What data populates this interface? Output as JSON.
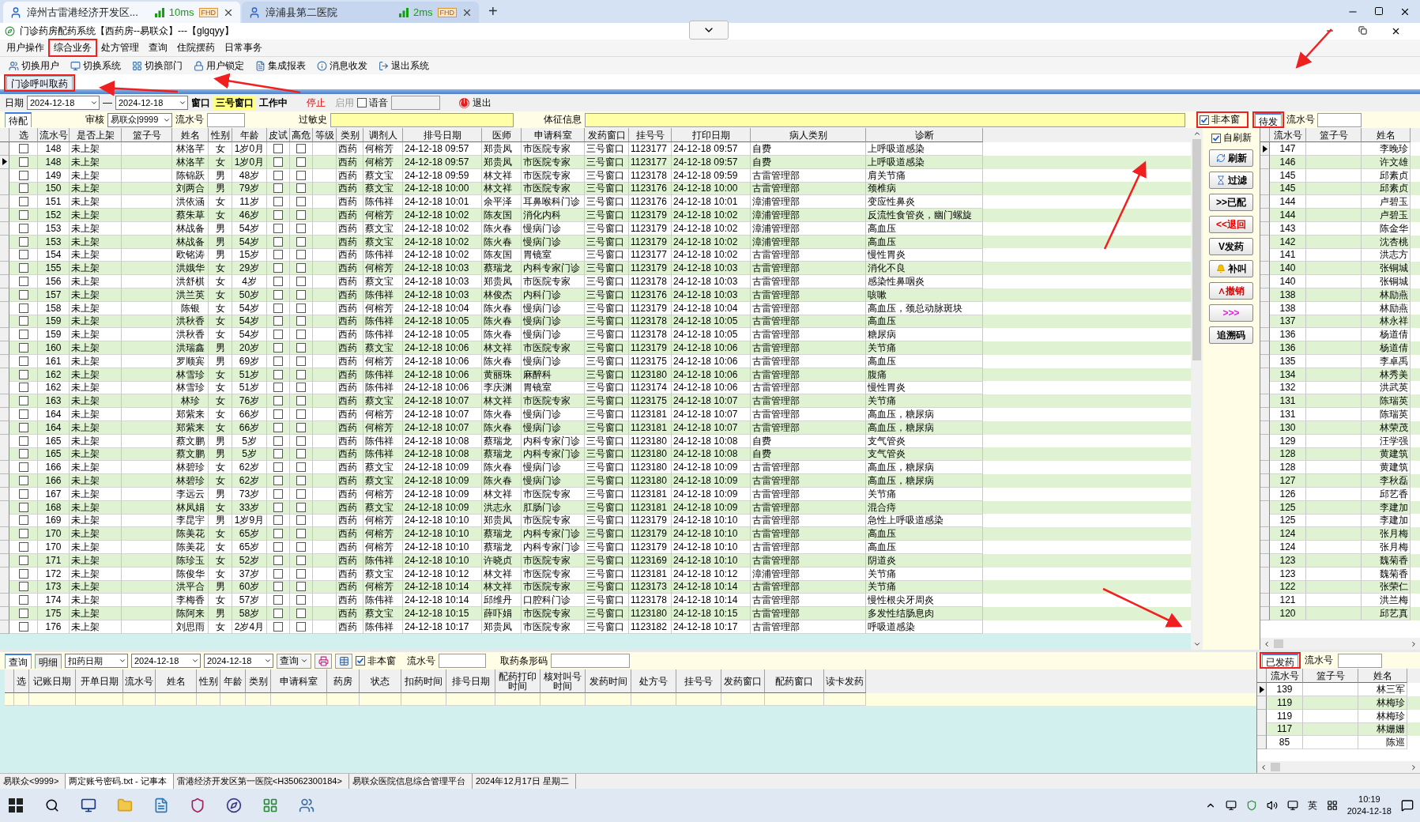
{
  "browser_tabs": [
    {
      "title": "漳州古雷港经济开发区...",
      "latency": "10ms",
      "badge": "FHD",
      "selected": true
    },
    {
      "title": "漳浦县第二医院",
      "latency": "2ms",
      "badge": "FHD",
      "selected": false
    }
  ],
  "new_tab": "+",
  "window": {
    "title": "门诊药房配药系统【西药房--易联众】---【glgqyy】"
  },
  "menu": [
    "用户操作",
    "综合业务",
    "处方管理",
    "查询",
    "住院摆药",
    "日常事务"
  ],
  "toolbar": [
    {
      "label": "切换用户",
      "kind": "users"
    },
    {
      "label": "切换系统",
      "kind": "system"
    },
    {
      "label": "切换部门",
      "kind": "dept"
    },
    {
      "label": "用户锁定",
      "kind": "lock"
    },
    {
      "label": "集成报表",
      "kind": "report"
    },
    {
      "label": "消息收发",
      "kind": "info"
    },
    {
      "label": "退出系统",
      "kind": "exit"
    }
  ],
  "page_tabs": [
    {
      "label": "门诊呼叫取药",
      "selected": true
    }
  ],
  "filter": {
    "date_label": "日期",
    "date_from": "2024-12-18",
    "date_sep": "—",
    "date_to": "2024-12-18",
    "window_label": "窗口",
    "window_value": "三号窗口",
    "status": "工作中",
    "stop": "停止",
    "enable": "启用",
    "voice": {
      "label": "语音",
      "checked": false
    },
    "exit": "退出"
  },
  "filter2": {
    "tab": "待配",
    "audit_label": "审核",
    "audit_value": "易联众|9999",
    "serial_label": "流水号",
    "allergy_label": "过敏史",
    "vitals_label": "体征信息"
  },
  "options": [
    {
      "label": "非本窗",
      "checked": true
    },
    {
      "label": "自刷新",
      "checked": true
    }
  ],
  "main_table": {
    "columns": [
      "选",
      "流水号",
      "是否上架",
      "篮子号",
      "姓名",
      "性别",
      "年龄",
      "皮试",
      "高危",
      "等级",
      "类别",
      "调剂人",
      "排号日期",
      "医师",
      "申请科室",
      "发药窗口",
      "挂号号",
      "打印日期",
      "病人类别",
      "诊断"
    ],
    "rows": [
      {
        "selected": false,
        "cells": [
          false,
          "148",
          "未上架",
          "",
          "林洛芊",
          "女",
          "1岁0月",
          false,
          false,
          "",
          "西药",
          "何榕芳",
          "24-12-18 09:57",
          "郑贵凤",
          "市医院专家",
          "三号窗口",
          "1123177",
          "24-12-18 09:57",
          "自费",
          "上呼吸道感染"
        ]
      },
      {
        "selected": true,
        "cells": [
          false,
          "148",
          "未上架",
          "",
          "林洛芊",
          "女",
          "1岁0月",
          false,
          false,
          "",
          "西药",
          "何榕芳",
          "24-12-18 09:57",
          "郑贵凤",
          "市医院专家",
          "三号窗口",
          "1123177",
          "24-12-18 09:57",
          "自费",
          "上呼吸道感染"
        ]
      },
      {
        "selected": false,
        "cells": [
          false,
          "149",
          "未上架",
          "",
          "陈锦跃",
          "男",
          "48岁",
          false,
          false,
          "",
          "西药",
          "蔡文宝",
          "24-12-18 09:59",
          "林文祥",
          "市医院专家",
          "三号窗口",
          "1123178",
          "24-12-18 09:59",
          "古雷管理部",
          "肩关节痛"
        ]
      },
      {
        "selected": false,
        "cells": [
          false,
          "150",
          "未上架",
          "",
          "刘两合",
          "男",
          "79岁",
          false,
          false,
          "",
          "西药",
          "蔡文宝",
          "24-12-18 10:00",
          "林文祥",
          "市医院专家",
          "三号窗口",
          "1123176",
          "24-12-18 10:00",
          "古雷管理部",
          "颈椎病"
        ]
      },
      {
        "selected": false,
        "cells": [
          false,
          "151",
          "未上架",
          "",
          "洪依涵",
          "女",
          "11岁",
          false,
          false,
          "",
          "西药",
          "陈伟祥",
          "24-12-18 10:01",
          "余平泽",
          "耳鼻喉科门诊",
          "三号窗口",
          "1123176",
          "24-12-18 10:01",
          "漳浦管理部",
          "变应性鼻炎"
        ]
      },
      {
        "selected": false,
        "cells": [
          false,
          "152",
          "未上架",
          "",
          "蔡朱草",
          "女",
          "46岁",
          false,
          false,
          "",
          "西药",
          "何榕芳",
          "24-12-18 10:02",
          "陈友国",
          "消化内科",
          "三号窗口",
          "1123179",
          "24-12-18 10:02",
          "漳浦管理部",
          "反流性食管炎，幽门螺旋"
        ]
      },
      {
        "selected": false,
        "cells": [
          false,
          "153",
          "未上架",
          "",
          "林战备",
          "男",
          "54岁",
          false,
          false,
          "",
          "西药",
          "蔡文宝",
          "24-12-18 10:02",
          "陈火春",
          "慢病门诊",
          "三号窗口",
          "1123179",
          "24-12-18 10:02",
          "漳浦管理部",
          "高血压"
        ]
      },
      {
        "selected": false,
        "cells": [
          false,
          "153",
          "未上架",
          "",
          "林战备",
          "男",
          "54岁",
          false,
          false,
          "",
          "西药",
          "蔡文宝",
          "24-12-18 10:02",
          "陈火春",
          "慢病门诊",
          "三号窗口",
          "1123179",
          "24-12-18 10:02",
          "漳浦管理部",
          "高血压"
        ]
      },
      {
        "selected": false,
        "cells": [
          false,
          "154",
          "未上架",
          "",
          "欧铭涛",
          "男",
          "15岁",
          false,
          false,
          "",
          "西药",
          "陈伟祥",
          "24-12-18 10:02",
          "陈友国",
          "胃镜室",
          "三号窗口",
          "1123177",
          "24-12-18 10:02",
          "古雷管理部",
          "慢性胃炎"
        ]
      },
      {
        "selected": false,
        "cells": [
          false,
          "155",
          "未上架",
          "",
          "洪娥华",
          "女",
          "29岁",
          false,
          false,
          "",
          "西药",
          "何榕芳",
          "24-12-18 10:03",
          "蔡瑞龙",
          "内科专家门诊",
          "三号窗口",
          "1123179",
          "24-12-18 10:03",
          "古雷管理部",
          "消化不良"
        ]
      },
      {
        "selected": false,
        "cells": [
          false,
          "156",
          "未上架",
          "",
          "洪舒棋",
          "女",
          "4岁",
          false,
          false,
          "",
          "西药",
          "蔡文宝",
          "24-12-18 10:03",
          "郑贵凤",
          "市医院专家",
          "三号窗口",
          "1123178",
          "24-12-18 10:03",
          "古雷管理部",
          "感染性鼻咽炎"
        ]
      },
      {
        "selected": false,
        "cells": [
          false,
          "157",
          "未上架",
          "",
          "洪兰英",
          "女",
          "50岁",
          false,
          false,
          "",
          "西药",
          "陈伟祥",
          "24-12-18 10:03",
          "林俊杰",
          "内科门诊",
          "三号窗口",
          "1123176",
          "24-12-18 10:03",
          "古雷管理部",
          "咳嗽"
        ]
      },
      {
        "selected": false,
        "cells": [
          false,
          "158",
          "未上架",
          "",
          "陈银",
          "女",
          "54岁",
          false,
          false,
          "",
          "西药",
          "何榕芳",
          "24-12-18 10:04",
          "陈火春",
          "慢病门诊",
          "三号窗口",
          "1123179",
          "24-12-18 10:04",
          "古雷管理部",
          "高血压，颈总动脉斑块"
        ]
      },
      {
        "selected": false,
        "cells": [
          false,
          "159",
          "未上架",
          "",
          "洪秋香",
          "女",
          "54岁",
          false,
          false,
          "",
          "西药",
          "陈伟祥",
          "24-12-18 10:05",
          "陈火春",
          "慢病门诊",
          "三号窗口",
          "1123178",
          "24-12-18 10:05",
          "古雷管理部",
          "高血压"
        ]
      },
      {
        "selected": false,
        "cells": [
          false,
          "159",
          "未上架",
          "",
          "洪秋香",
          "女",
          "54岁",
          false,
          false,
          "",
          "西药",
          "陈伟祥",
          "24-12-18 10:05",
          "陈火春",
          "慢病门诊",
          "三号窗口",
          "1123178",
          "24-12-18 10:05",
          "古雷管理部",
          "糖尿病"
        ]
      },
      {
        "selected": false,
        "cells": [
          false,
          "160",
          "未上架",
          "",
          "洪瑞鑫",
          "男",
          "20岁",
          false,
          false,
          "",
          "西药",
          "蔡文宝",
          "24-12-18 10:06",
          "林文祥",
          "市医院专家",
          "三号窗口",
          "1123179",
          "24-12-18 10:06",
          "古雷管理部",
          "关节痛"
        ]
      },
      {
        "selected": false,
        "cells": [
          false,
          "161",
          "未上架",
          "",
          "罗顺宾",
          "男",
          "69岁",
          false,
          false,
          "",
          "西药",
          "何榕芳",
          "24-12-18 10:06",
          "陈火春",
          "慢病门诊",
          "三号窗口",
          "1123175",
          "24-12-18 10:06",
          "古雷管理部",
          "高血压"
        ]
      },
      {
        "selected": false,
        "cells": [
          false,
          "162",
          "未上架",
          "",
          "林雪珍",
          "女",
          "51岁",
          false,
          false,
          "",
          "西药",
          "陈伟祥",
          "24-12-18 10:06",
          "黄丽珠",
          "麻醉科",
          "三号窗口",
          "1123180",
          "24-12-18 10:06",
          "古雷管理部",
          "腹痛"
        ]
      },
      {
        "selected": false,
        "cells": [
          false,
          "162",
          "未上架",
          "",
          "林雪珍",
          "女",
          "51岁",
          false,
          false,
          "",
          "西药",
          "陈伟祥",
          "24-12-18 10:06",
          "李庆渊",
          "胃镜室",
          "三号窗口",
          "1123174",
          "24-12-18 10:06",
          "古雷管理部",
          "慢性胃炎"
        ]
      },
      {
        "selected": false,
        "cells": [
          false,
          "163",
          "未上架",
          "",
          "林珍",
          "女",
          "76岁",
          false,
          false,
          "",
          "西药",
          "蔡文宝",
          "24-12-18 10:07",
          "林文祥",
          "市医院专家",
          "三号窗口",
          "1123175",
          "24-12-18 10:07",
          "古雷管理部",
          "关节痛"
        ]
      },
      {
        "selected": false,
        "cells": [
          false,
          "164",
          "未上架",
          "",
          "郑紫来",
          "女",
          "66岁",
          false,
          false,
          "",
          "西药",
          "何榕芳",
          "24-12-18 10:07",
          "陈火春",
          "慢病门诊",
          "三号窗口",
          "1123181",
          "24-12-18 10:07",
          "古雷管理部",
          "高血压，糖尿病"
        ]
      },
      {
        "selected": false,
        "cells": [
          false,
          "164",
          "未上架",
          "",
          "郑紫来",
          "女",
          "66岁",
          false,
          false,
          "",
          "西药",
          "何榕芳",
          "24-12-18 10:07",
          "陈火春",
          "慢病门诊",
          "三号窗口",
          "1123181",
          "24-12-18 10:07",
          "古雷管理部",
          "高血压，糖尿病"
        ]
      },
      {
        "selected": false,
        "cells": [
          false,
          "165",
          "未上架",
          "",
          "蔡文鹏",
          "男",
          "5岁",
          false,
          false,
          "",
          "西药",
          "陈伟祥",
          "24-12-18 10:08",
          "蔡瑞龙",
          "内科专家门诊",
          "三号窗口",
          "1123180",
          "24-12-18 10:08",
          "自费",
          "支气管炎"
        ]
      },
      {
        "selected": false,
        "cells": [
          false,
          "165",
          "未上架",
          "",
          "蔡文鹏",
          "男",
          "5岁",
          false,
          false,
          "",
          "西药",
          "陈伟祥",
          "24-12-18 10:08",
          "蔡瑞龙",
          "内科专家门诊",
          "三号窗口",
          "1123180",
          "24-12-18 10:08",
          "自费",
          "支气管炎"
        ]
      },
      {
        "selected": false,
        "cells": [
          false,
          "166",
          "未上架",
          "",
          "林碧珍",
          "女",
          "62岁",
          false,
          false,
          "",
          "西药",
          "蔡文宝",
          "24-12-18 10:09",
          "陈火春",
          "慢病门诊",
          "三号窗口",
          "1123180",
          "24-12-18 10:09",
          "古雷管理部",
          "高血压，糖尿病"
        ]
      },
      {
        "selected": false,
        "cells": [
          false,
          "166",
          "未上架",
          "",
          "林碧珍",
          "女",
          "62岁",
          false,
          false,
          "",
          "西药",
          "蔡文宝",
          "24-12-18 10:09",
          "陈火春",
          "慢病门诊",
          "三号窗口",
          "1123180",
          "24-12-18 10:09",
          "古雷管理部",
          "高血压，糖尿病"
        ]
      },
      {
        "selected": false,
        "cells": [
          false,
          "167",
          "未上架",
          "",
          "李远云",
          "男",
          "73岁",
          false,
          false,
          "",
          "西药",
          "何榕芳",
          "24-12-18 10:09",
          "林文祥",
          "市医院专家",
          "三号窗口",
          "1123181",
          "24-12-18 10:09",
          "古雷管理部",
          "关节痛"
        ]
      },
      {
        "selected": false,
        "cells": [
          false,
          "168",
          "未上架",
          "",
          "林凤娟",
          "女",
          "33岁",
          false,
          false,
          "",
          "西药",
          "蔡文宝",
          "24-12-18 10:09",
          "洪志永",
          "肛肠门诊",
          "三号窗口",
          "1123181",
          "24-12-18 10:09",
          "古雷管理部",
          "混合痔"
        ]
      },
      {
        "selected": false,
        "cells": [
          false,
          "169",
          "未上架",
          "",
          "李昆宇",
          "男",
          "1岁9月",
          false,
          false,
          "",
          "西药",
          "何榕芳",
          "24-12-18 10:10",
          "郑贵凤",
          "市医院专家",
          "三号窗口",
          "1123179",
          "24-12-18 10:10",
          "古雷管理部",
          "急性上呼吸道感染"
        ]
      },
      {
        "selected": false,
        "cells": [
          false,
          "170",
          "未上架",
          "",
          "陈美花",
          "女",
          "65岁",
          false,
          false,
          "",
          "西药",
          "何榕芳",
          "24-12-18 10:10",
          "蔡瑞龙",
          "内科专家门诊",
          "三号窗口",
          "1123179",
          "24-12-18 10:10",
          "古雷管理部",
          "高血压"
        ]
      },
      {
        "selected": false,
        "cells": [
          false,
          "170",
          "未上架",
          "",
          "陈美花",
          "女",
          "65岁",
          false,
          false,
          "",
          "西药",
          "何榕芳",
          "24-12-18 10:10",
          "蔡瑞龙",
          "内科专家门诊",
          "三号窗口",
          "1123179",
          "24-12-18 10:10",
          "古雷管理部",
          "高血压"
        ]
      },
      {
        "selected": false,
        "cells": [
          false,
          "171",
          "未上架",
          "",
          "陈珍玉",
          "女",
          "52岁",
          false,
          false,
          "",
          "西药",
          "陈伟祥",
          "24-12-18 10:10",
          "许晓贞",
          "市医院专家",
          "三号窗口",
          "1123169",
          "24-12-18 10:10",
          "古雷管理部",
          "阴道炎"
        ]
      },
      {
        "selected": false,
        "cells": [
          false,
          "172",
          "未上架",
          "",
          "陈俊华",
          "女",
          "37岁",
          false,
          false,
          "",
          "西药",
          "蔡文宝",
          "24-12-18 10:12",
          "林文祥",
          "市医院专家",
          "三号窗口",
          "1123181",
          "24-12-18 10:12",
          "漳浦管理部",
          "关节痛"
        ]
      },
      {
        "selected": false,
        "cells": [
          false,
          "173",
          "未上架",
          "",
          "洪平合",
          "男",
          "60岁",
          false,
          false,
          "",
          "西药",
          "何榕芳",
          "24-12-18 10:14",
          "林文祥",
          "市医院专家",
          "三号窗口",
          "1123173",
          "24-12-18 10:14",
          "古雷管理部",
          "关节痛"
        ]
      },
      {
        "selected": false,
        "cells": [
          false,
          "174",
          "未上架",
          "",
          "李梅香",
          "女",
          "57岁",
          false,
          false,
          "",
          "西药",
          "陈伟祥",
          "24-12-18 10:14",
          "邱维丹",
          "口腔科门诊",
          "三号窗口",
          "1123178",
          "24-12-18 10:14",
          "古雷管理部",
          "慢性根尖牙周炎"
        ]
      },
      {
        "selected": false,
        "cells": [
          false,
          "175",
          "未上架",
          "",
          "陈阿来",
          "男",
          "58岁",
          false,
          false,
          "",
          "西药",
          "蔡文宝",
          "24-12-18 10:15",
          "薛吓娟",
          "市医院专家",
          "三号窗口",
          "1123180",
          "24-12-18 10:15",
          "古雷管理部",
          "多发性结肠息肉"
        ]
      },
      {
        "selected": false,
        "cells": [
          false,
          "176",
          "未上架",
          "",
          "刘思雨",
          "女",
          "2岁4月",
          false,
          false,
          "",
          "西药",
          "陈伟祥",
          "24-12-18 10:17",
          "郑贵凤",
          "市医院专家",
          "三号窗口",
          "1123182",
          "24-12-18 10:17",
          "古雷管理部",
          "呼吸道感染"
        ]
      }
    ]
  },
  "actions": [
    {
      "label": "刷新",
      "kind": "refresh"
    },
    {
      "label": "过滤",
      "kind": "filter"
    },
    {
      "label": ">>已配",
      "kind": "text"
    },
    {
      "label": "<<退回",
      "kind": "alert"
    },
    {
      "label": "V发药",
      "kind": "text"
    },
    {
      "label": "补叫",
      "kind": "bell"
    },
    {
      "label": "∧撤销",
      "kind": "alert"
    },
    {
      "label": ">>>",
      "kind": "more"
    },
    {
      "label": "追溯码",
      "kind": "text"
    }
  ],
  "pending": {
    "tab": "待发",
    "serial_label": "流水号",
    "columns": [
      "流水号",
      "篮子号",
      "姓名"
    ],
    "rows": [
      {
        "selected": true,
        "seq": "147",
        "name": "李晚珍"
      },
      {
        "selected": false,
        "seq": "146",
        "name": "许文雄"
      },
      {
        "selected": false,
        "seq": "145",
        "name": "邱素贞"
      },
      {
        "selected": false,
        "seq": "145",
        "name": "邱素贞"
      },
      {
        "selected": false,
        "seq": "144",
        "name": "卢碧玉"
      },
      {
        "selected": false,
        "seq": "144",
        "name": "卢碧玉"
      },
      {
        "selected": false,
        "seq": "143",
        "name": "陈金华"
      },
      {
        "selected": false,
        "seq": "142",
        "name": "沈杏桃"
      },
      {
        "selected": false,
        "seq": "141",
        "name": "洪志方"
      },
      {
        "selected": false,
        "seq": "140",
        "name": "张铜城"
      },
      {
        "selected": false,
        "seq": "140",
        "name": "张铜城"
      },
      {
        "selected": false,
        "seq": "138",
        "name": "林励燕"
      },
      {
        "selected": false,
        "seq": "138",
        "name": "林励燕"
      },
      {
        "selected": false,
        "seq": "137",
        "name": "林永祥"
      },
      {
        "selected": false,
        "seq": "136",
        "name": "杨道倩"
      },
      {
        "selected": false,
        "seq": "136",
        "name": "杨道倩"
      },
      {
        "selected": false,
        "seq": "135",
        "name": "李卓禹"
      },
      {
        "selected": false,
        "seq": "134",
        "name": "林秀美"
      },
      {
        "selected": false,
        "seq": "132",
        "name": "洪武英"
      },
      {
        "selected": false,
        "seq": "131",
        "name": "陈瑞英"
      },
      {
        "selected": false,
        "seq": "131",
        "name": "陈瑞英"
      },
      {
        "selected": false,
        "seq": "130",
        "name": "林荣茂"
      },
      {
        "selected": false,
        "seq": "129",
        "name": "汪学强"
      },
      {
        "selected": false,
        "seq": "128",
        "name": "黄建筑"
      },
      {
        "selected": false,
        "seq": "128",
        "name": "黄建筑"
      },
      {
        "selected": false,
        "seq": "127",
        "name": "李秋磊"
      },
      {
        "selected": false,
        "seq": "126",
        "name": "邱艺香"
      },
      {
        "selected": false,
        "seq": "125",
        "name": "李建加"
      },
      {
        "selected": false,
        "seq": "125",
        "name": "李建加"
      },
      {
        "selected": false,
        "seq": "124",
        "name": "张月梅"
      },
      {
        "selected": false,
        "seq": "124",
        "name": "张月梅"
      },
      {
        "selected": false,
        "seq": "123",
        "name": "魏菊香"
      },
      {
        "selected": false,
        "seq": "123",
        "name": "魏菊香"
      },
      {
        "selected": false,
        "seq": "122",
        "name": "张荣仁"
      },
      {
        "selected": false,
        "seq": "121",
        "name": "洪兰梅"
      },
      {
        "selected": false,
        "seq": "120",
        "name": "邱艺真"
      }
    ]
  },
  "bottom": {
    "tabs": [
      {
        "label": "查询",
        "selected": true
      },
      {
        "label": "明细",
        "selected": false
      }
    ],
    "date_type": "扣药日期",
    "date_from": "2024-12-18",
    "date_to": "2024-12-18",
    "query": "查询",
    "not_this_window": {
      "label": "非本窗",
      "checked": true
    },
    "serial_label": "流水号",
    "barcode_label": "取药条形码",
    "columns": [
      "选",
      "记账日期",
      "开单日期",
      "流水号",
      "姓名",
      "性别",
      "年龄",
      "类别",
      "申请科室",
      "药房",
      "状态",
      "扣药时间",
      "排号日期",
      "配药打印时间",
      "核对叫号时间",
      "发药时间",
      "处方号",
      "挂号号",
      "发药窗口",
      "配药窗口",
      "读卡发药"
    ]
  },
  "dispensed": {
    "tab": "已发药",
    "serial_label": "流水号",
    "columns": [
      "流水号",
      "篮子号",
      "姓名"
    ],
    "rows": [
      {
        "selected": true,
        "seq": "139",
        "name": "林三军"
      },
      {
        "selected": false,
        "seq": "119",
        "name": "林梅珍"
      },
      {
        "selected": false,
        "seq": "119",
        "name": "林梅珍"
      },
      {
        "selected": false,
        "seq": "117",
        "name": "林姗姗"
      },
      {
        "selected": false,
        "seq": "85",
        "name": "陈巡"
      }
    ]
  },
  "status_bar": [
    "易联众<9999>",
    "两定账号密码.txt - 记事本",
    "雷港经济开发区第一医院<H35062300184>",
    "易联众医院信息综合管理平台",
    "2024年12月17日 星期二"
  ],
  "taskbar": {
    "ime": "英",
    "time": "10:19",
    "date": "2024-12-18"
  }
}
